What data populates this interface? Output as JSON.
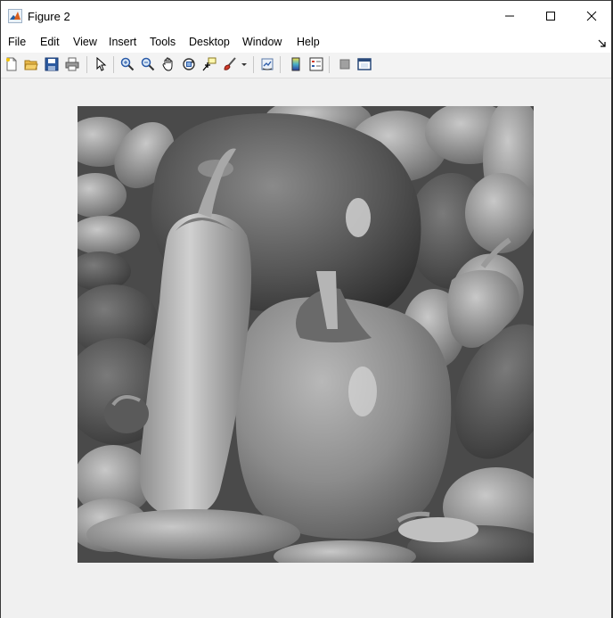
{
  "window": {
    "title": "Figure 2",
    "accent": "#d95f1f"
  },
  "menu": {
    "items": [
      "File",
      "Edit",
      "View",
      "Insert",
      "Tools",
      "Desktop",
      "Window",
      "Help"
    ]
  },
  "toolbar": {
    "icons": [
      "new-figure-icon",
      "open-file-icon",
      "save-icon",
      "print-icon",
      "edit-plot-arrow-icon",
      "zoom-in-icon",
      "zoom-out-icon",
      "pan-hand-icon",
      "rotate-3d-icon",
      "data-cursor-icon",
      "brush-icon",
      "link-plot-icon",
      "colorbar-icon",
      "legend-icon",
      "hide-plot-tools-icon",
      "show-plot-tools-icon"
    ]
  },
  "figure": {
    "image_description_colors": {
      "background": "#f0f0f0",
      "image_bg": "#555555"
    }
  }
}
